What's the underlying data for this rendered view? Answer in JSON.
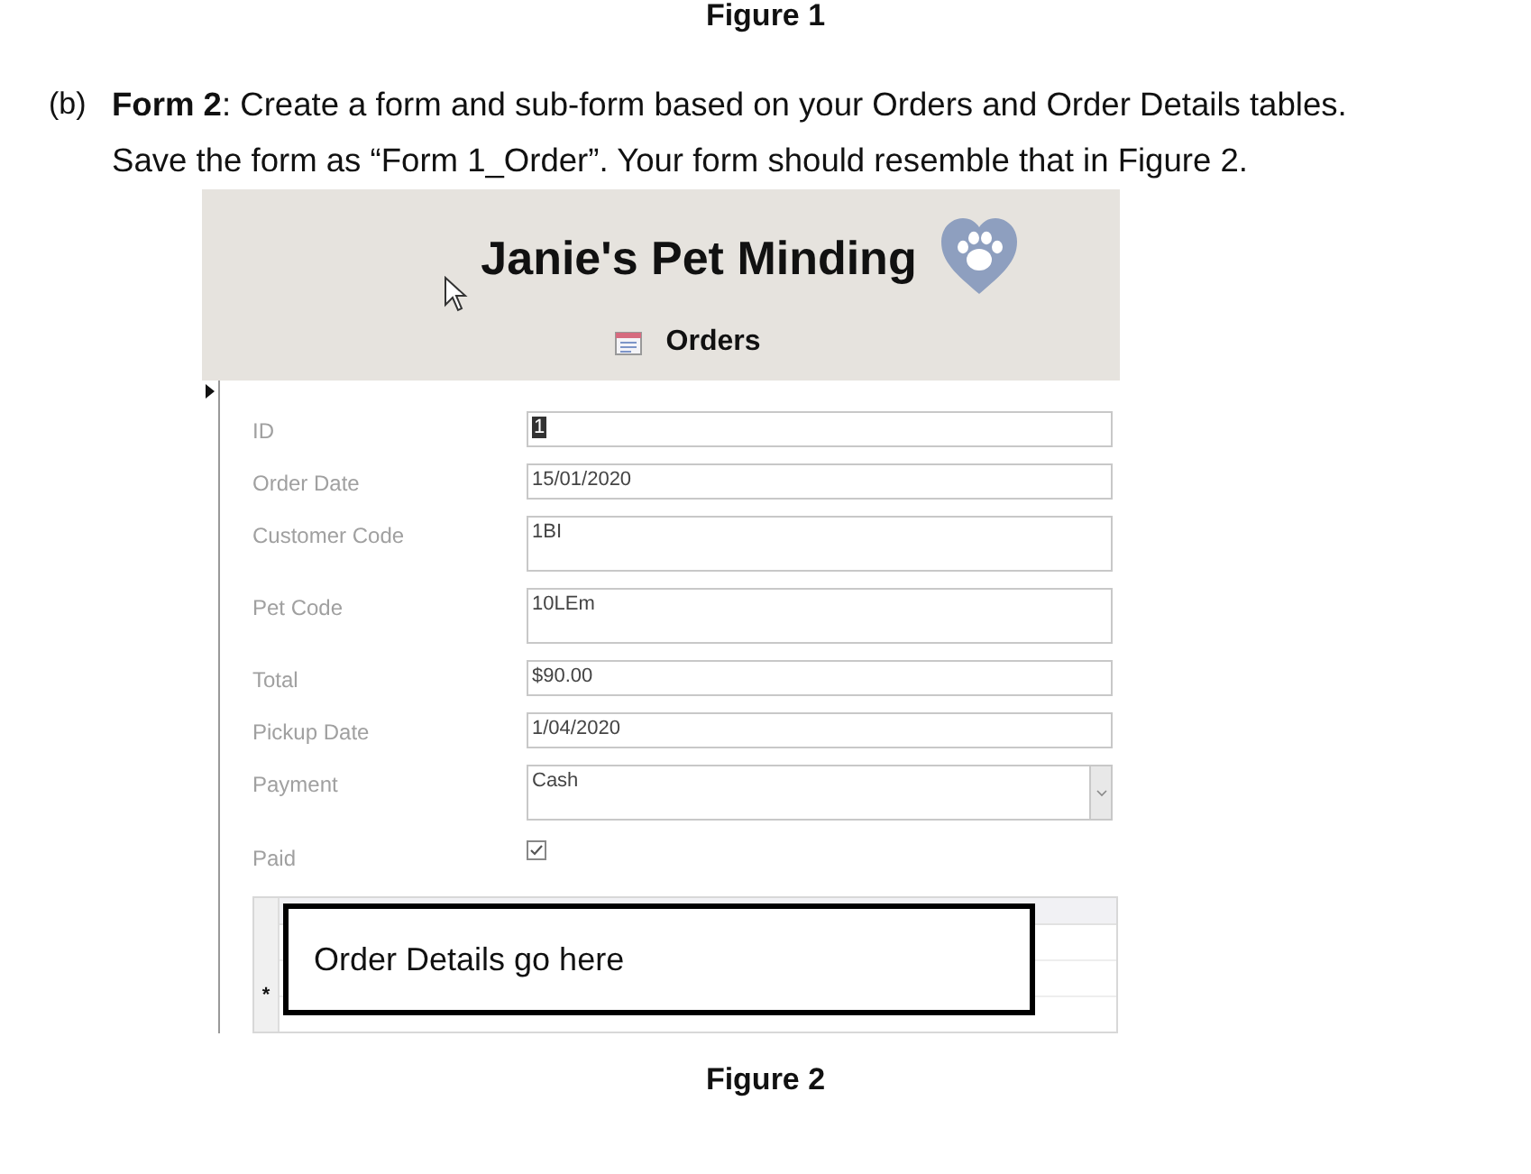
{
  "figure_top_caption": "Figure 1",
  "question": {
    "marker": "(b)",
    "text": "**Form 2**: Create a form and sub-form based on your Orders and Order Details tables. Save the form as “Form 1_Order”. Your form should resemble that in Figure 2."
  },
  "form": {
    "title": "Janie's Pet Minding",
    "subtitle": "Orders",
    "fields": [
      {
        "label": "ID",
        "kind": "text",
        "value": "1",
        "selected": true
      },
      {
        "label": "Order Date",
        "kind": "text",
        "value": "15/01/2020",
        "selected": false
      },
      {
        "label": "Customer Code",
        "kind": "memo",
        "value": "1BI",
        "selected": false
      },
      {
        "label": "Pet Code",
        "kind": "memo",
        "value": "10LEm",
        "selected": false
      },
      {
        "label": "Total",
        "kind": "text",
        "value": "$90.00",
        "selected": false
      },
      {
        "label": "Pickup Date",
        "kind": "text",
        "value": "1/04/2020",
        "selected": false
      },
      {
        "label": "Payment",
        "kind": "combo",
        "value": "Cash",
        "selected": false
      },
      {
        "label": "Paid",
        "kind": "checkbox",
        "checked": true
      }
    ],
    "subform": {
      "new_row_marker": "*",
      "callout": "Order Details go here"
    }
  },
  "figure_caption": "Figure 2"
}
